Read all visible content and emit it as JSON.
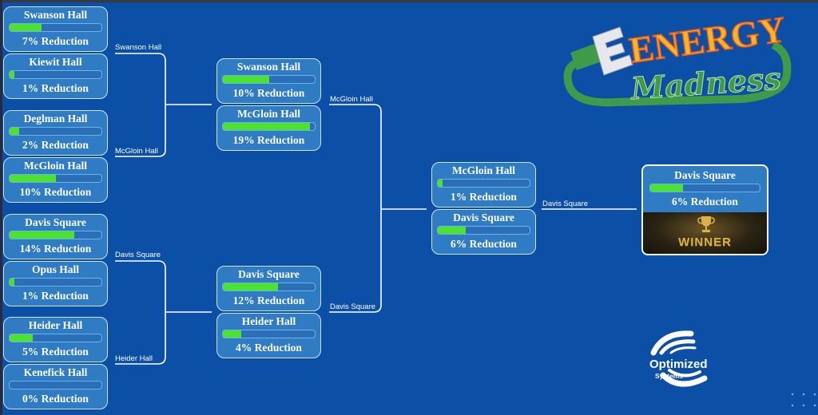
{
  "logo": {
    "line1": "ENERGY",
    "line2": "Madness"
  },
  "sponsor": {
    "line1": "Optimized",
    "line2": "Systems"
  },
  "colors": {
    "background": "#0b4fa6",
    "card": "#2f7bc4",
    "progress": "#4be32d",
    "logo_orange": "#f7b52a",
    "logo_green": "#3f9a4a"
  },
  "bracket": {
    "round1": [
      {
        "name": "Swanson Hall",
        "pct": 7,
        "label": "7% Reduction"
      },
      {
        "name": "Kiewit Hall",
        "pct": 1,
        "label": "1% Reduction"
      },
      {
        "name": "Deglman Hall",
        "pct": 2,
        "label": "2% Reduction"
      },
      {
        "name": "McGloin Hall",
        "pct": 10,
        "label": "10% Reduction"
      },
      {
        "name": "Davis Square",
        "pct": 14,
        "label": "14% Reduction"
      },
      {
        "name": "Opus Hall",
        "pct": 1,
        "label": "1% Reduction"
      },
      {
        "name": "Heider Hall",
        "pct": 5,
        "label": "5% Reduction"
      },
      {
        "name": "Kenefick Hall",
        "pct": 0,
        "label": "0% Reduction"
      }
    ],
    "round1_winners": [
      "Swanson Hall",
      "McGloin Hall",
      "Davis Square",
      "Heider Hall"
    ],
    "round2": [
      {
        "name": "Swanson Hall",
        "pct": 10,
        "label": "10% Reduction"
      },
      {
        "name": "McGloin Hall",
        "pct": 19,
        "label": "19% Reduction"
      },
      {
        "name": "Davis Square",
        "pct": 12,
        "label": "12% Reduction"
      },
      {
        "name": "Heider Hall",
        "pct": 4,
        "label": "4% Reduction"
      }
    ],
    "round2_winners": [
      "McGloin Hall",
      "Davis Square"
    ],
    "round3": [
      {
        "name": "McGloin Hall",
        "pct": 1,
        "label": "1% Reduction"
      },
      {
        "name": "Davis Square",
        "pct": 6,
        "label": "6% Reduction"
      }
    ],
    "round3_winner": "Davis Square",
    "champion": {
      "name": "Davis Square",
      "pct": 6,
      "label": "6% Reduction",
      "badge": "WINNER"
    },
    "bar_max_pct": 20
  }
}
